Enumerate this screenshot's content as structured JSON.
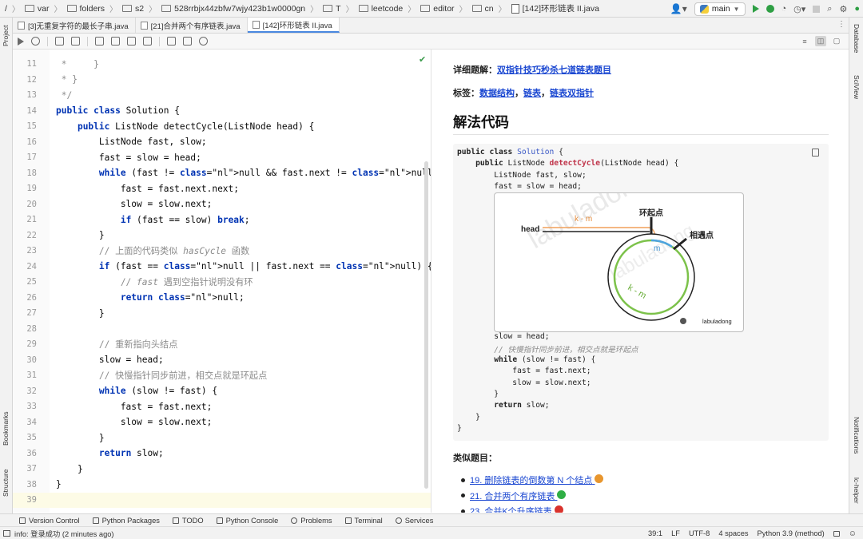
{
  "breadcrumbs": [
    "/",
    "var",
    "folders",
    "s2",
    "528rrbjx44zbfw7wjy423b1w0000gn",
    "T",
    "leetcode",
    "editor",
    "cn",
    "[142]环形链表 II.java"
  ],
  "branch": "main",
  "tabs": [
    {
      "label": "[3]无重复字符的最长子串.java",
      "active": false
    },
    {
      "label": "[21]合并两个有序链表.java",
      "active": false
    },
    {
      "label": "[142]环形链表 II.java",
      "active": true
    }
  ],
  "left_strip": {
    "project": "Project",
    "bookmarks": "Bookmarks",
    "structure": "Structure"
  },
  "right_strip": {
    "database": "Database",
    "sciview": "SciView",
    "notifications": "Notifications",
    "lc_helper": "lc-helper"
  },
  "editor": {
    "lines": [
      {
        "n": "11",
        "code": " *     }"
      },
      {
        "n": "12",
        "code": " * }"
      },
      {
        "n": "13",
        "code": " */"
      },
      {
        "n": "14",
        "code": "public class Solution {"
      },
      {
        "n": "15",
        "code": "    public ListNode detectCycle(ListNode head) {"
      },
      {
        "n": "16",
        "code": "        ListNode fast, slow;"
      },
      {
        "n": "17",
        "code": "        fast = slow = head;"
      },
      {
        "n": "18",
        "code": "        while (fast != null && fast.next != null) {"
      },
      {
        "n": "19",
        "code": "            fast = fast.next.next;"
      },
      {
        "n": "20",
        "code": "            slow = slow.next;"
      },
      {
        "n": "21",
        "code": "            if (fast == slow) break;"
      },
      {
        "n": "22",
        "code": "        }"
      },
      {
        "n": "23",
        "code": "        // 上面的代码类似 hasCycle 函数"
      },
      {
        "n": "24",
        "code": "        if (fast == null || fast.next == null) {"
      },
      {
        "n": "25",
        "code": "            // fast 遇到空指针说明没有环"
      },
      {
        "n": "26",
        "code": "            return null;"
      },
      {
        "n": "27",
        "code": "        }"
      },
      {
        "n": "28",
        "code": ""
      },
      {
        "n": "29",
        "code": "        // 重新指向头结点"
      },
      {
        "n": "30",
        "code": "        slow = head;"
      },
      {
        "n": "31",
        "code": "        // 快慢指针同步前进，相交点就是环起点"
      },
      {
        "n": "32",
        "code": "        while (slow != fast) {"
      },
      {
        "n": "33",
        "code": "            fast = fast.next;"
      },
      {
        "n": "34",
        "code": "            slow = slow.next;"
      },
      {
        "n": "35",
        "code": "        }"
      },
      {
        "n": "36",
        "code": "        return slow;"
      },
      {
        "n": "37",
        "code": "    }"
      },
      {
        "n": "38",
        "code": "}"
      },
      {
        "n": "39",
        "code": ""
      }
    ],
    "current_line": "39"
  },
  "preview": {
    "detail_label": "详细题解：",
    "detail_link": "双指针技巧秒杀七道链表题目",
    "tags_label": "标签：",
    "tags": [
      "数据结构",
      "链表",
      "链表双指针"
    ],
    "heading": "解法代码",
    "code_top": [
      "public class Solution {",
      "    public ListNode detectCycle(ListNode head) {",
      "        ListNode fast, slow;",
      "        fast = slow = head;"
    ],
    "code_bottom": [
      "        slow = head;",
      "        // 快慢指针同步前进，相交点就是环起点",
      "        while (slow != fast) {",
      "            fast = fast.next;",
      "            slow = slow.next;",
      "        }",
      "        return slow;",
      "    }",
      "}"
    ],
    "diagram": {
      "head": "head",
      "k_minus_m_top": "k - m",
      "cycle_start": "环起点",
      "meet_point": "相遇点",
      "m": "m",
      "k_minus_m_arc": "k - m",
      "credit": "labuladong",
      "watermark": "labuladong"
    },
    "similar_label": "类似题目",
    "similar": [
      {
        "label": "19. 删除链表的倒数第 N 个结点",
        "color": "#e8962e"
      },
      {
        "label": "21. 合并两个有序链表",
        "color": "#2fae45"
      },
      {
        "label": "23. 合并K个升序链表",
        "color": "#d9322c"
      }
    ]
  },
  "bottom_tools": [
    "Version Control",
    "Python Packages",
    "TODO",
    "Python Console",
    "Problems",
    "Terminal",
    "Services"
  ],
  "status": {
    "message": "info: 登录成功 (2 minutes ago)",
    "position": "39:1",
    "line_sep": "LF",
    "encoding": "UTF-8",
    "indent": "4 spaces",
    "interpreter": "Python 3.9 (method)"
  },
  "colors": {
    "keyword": "#0033b3",
    "literal": "#871094",
    "comment": "#8c8c8c",
    "link": "#1a47d1",
    "accent_tab": "#4a88e0",
    "run_green": "#2e9f44"
  }
}
